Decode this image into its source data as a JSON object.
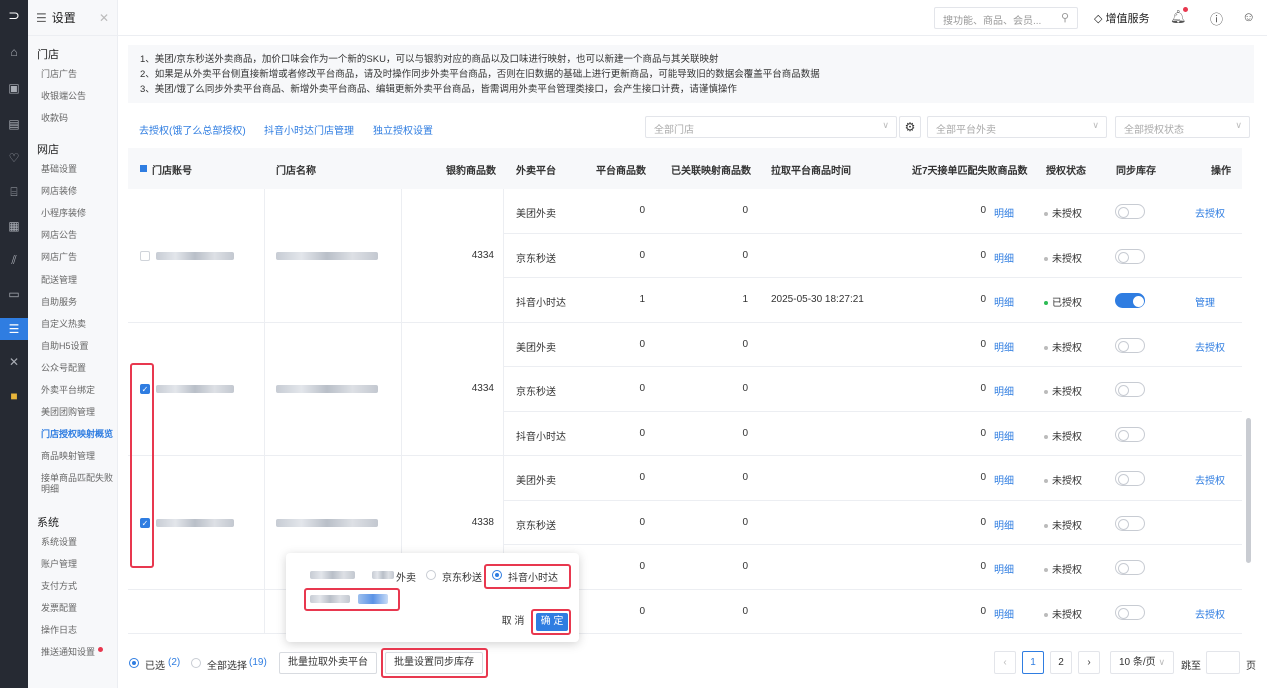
{
  "sidebar": {
    "title": "设置",
    "groups": [
      {
        "label": "门店",
        "items": [
          "门店广告",
          "收银端公告",
          "收款码"
        ]
      },
      {
        "label": "网店",
        "items": [
          "基础设置",
          "网店装修",
          "小程序装修",
          "网店公告",
          "网店广告",
          "配送管理",
          "自助服务",
          "自定义热卖",
          "自助H5设置",
          "公众号配置",
          "外卖平台绑定",
          "美团团购管理",
          "门店授权映射概览",
          "商品映射管理",
          "接单商品匹配失败明细"
        ]
      },
      {
        "label": "系统",
        "items": [
          "系统设置",
          "账户管理",
          "支付方式",
          "发票配置",
          "操作日志",
          "推送通知设置"
        ]
      }
    ],
    "active_item": "门店授权映射概览"
  },
  "topbar": {
    "search_placeholder": "搜功能、商品、会员...",
    "value_added": "增值服务"
  },
  "notice": [
    "1、美团/京东秒送外卖商品，加价口味会作为一个新的SKU，可以与银豹对应的商品以及口味进行映射，也可以新建一个商品与其关联映射",
    "2、如果是从外卖平台侧直接新增或者修改平台商品，请及时操作同步外卖平台商品，否则在旧数据的基础上进行更新商品，可能导致旧的数据会覆盖平台商品数据",
    "3、美团/饿了么同步外卖平台商品、新增外卖平台商品、编辑更新外卖平台商品，皆需调用外卖平台管理类接口，会产生接口计费，请谨慎操作"
  ],
  "actions": {
    "auth_link": "去授权(饿了么总部授权)",
    "douyin_link": "抖音小时达门店管理",
    "independent_link": "独立授权设置"
  },
  "filters": {
    "store": "全部门店",
    "platform": "全部平台外卖",
    "auth": "全部授权状态"
  },
  "table": {
    "headers": [
      "门店账号",
      "门店名称",
      "银豹商品数",
      "外卖平台",
      "平台商品数",
      "已关联映射商品数",
      "拉取平台商品时间",
      "近7天接单匹配失败商品数",
      "授权状态",
      "同步库存",
      "操作"
    ],
    "groups": [
      {
        "count": "4334",
        "checked": false,
        "rows": [
          {
            "platform": "美团外卖",
            "pcount": "0",
            "mapped": "0",
            "time": "",
            "fail": "0",
            "detail": "明细",
            "auth": "未授权",
            "auth_on": false,
            "sync": false,
            "op": "去授权"
          },
          {
            "platform": "京东秒送",
            "pcount": "0",
            "mapped": "0",
            "time": "",
            "fail": "0",
            "detail": "明细",
            "auth": "未授权",
            "auth_on": false,
            "sync": false,
            "op": ""
          },
          {
            "platform": "抖音小时达",
            "pcount": "1",
            "mapped": "1",
            "time": "2025-05-30 18:27:21",
            "fail": "0",
            "detail": "明细",
            "auth": "已授权",
            "auth_on": true,
            "sync": true,
            "op": "管理"
          }
        ]
      },
      {
        "count": "4334",
        "checked": true,
        "rows": [
          {
            "platform": "美团外卖",
            "pcount": "0",
            "mapped": "0",
            "time": "",
            "fail": "0",
            "detail": "明细",
            "auth": "未授权",
            "auth_on": false,
            "sync": false,
            "op": "去授权"
          },
          {
            "platform": "京东秒送",
            "pcount": "0",
            "mapped": "0",
            "time": "",
            "fail": "0",
            "detail": "明细",
            "auth": "未授权",
            "auth_on": false,
            "sync": false,
            "op": ""
          },
          {
            "platform": "抖音小时达",
            "pcount": "0",
            "mapped": "0",
            "time": "",
            "fail": "0",
            "detail": "明细",
            "auth": "未授权",
            "auth_on": false,
            "sync": false,
            "op": ""
          }
        ]
      },
      {
        "count": "4338",
        "checked": true,
        "rows": [
          {
            "platform": "美团外卖",
            "pcount": "0",
            "mapped": "0",
            "time": "",
            "fail": "0",
            "detail": "明细",
            "auth": "未授权",
            "auth_on": false,
            "sync": false,
            "op": "去授权"
          },
          {
            "platform": "京东秒送",
            "pcount": "0",
            "mapped": "0",
            "time": "",
            "fail": "0",
            "detail": "明细",
            "auth": "未授权",
            "auth_on": false,
            "sync": false,
            "op": ""
          },
          {
            "platform": "",
            "pcount": "0",
            "mapped": "0",
            "time": "",
            "fail": "0",
            "detail": "明细",
            "auth": "未授权",
            "auth_on": false,
            "sync": false,
            "op": ""
          }
        ]
      },
      {
        "count": "",
        "checked": false,
        "rows": [
          {
            "platform": "",
            "pcount": "0",
            "mapped": "0",
            "time": "",
            "fail": "0",
            "detail": "明细",
            "auth": "未授权",
            "auth_on": false,
            "sync": false,
            "op": "去授权"
          }
        ]
      }
    ]
  },
  "popup": {
    "opt1": "外卖",
    "opt2": "京东秒送",
    "opt3": "抖音小时达",
    "cancel": "取 消",
    "confirm": "确 定"
  },
  "footer": {
    "selected_label": "已选",
    "selected_count": "(2)",
    "all_label": "全部选择",
    "all_count": "(19)",
    "batch_pull": "批量拉取外卖平台",
    "batch_sync": "批量设置同步库存",
    "pages": [
      "1",
      "2"
    ],
    "page_size": "10 条/页",
    "jump_label": "跳至",
    "page_unit": "页"
  },
  "colors": {
    "accent": "#2f7de1",
    "highlight": "#e8384f"
  }
}
